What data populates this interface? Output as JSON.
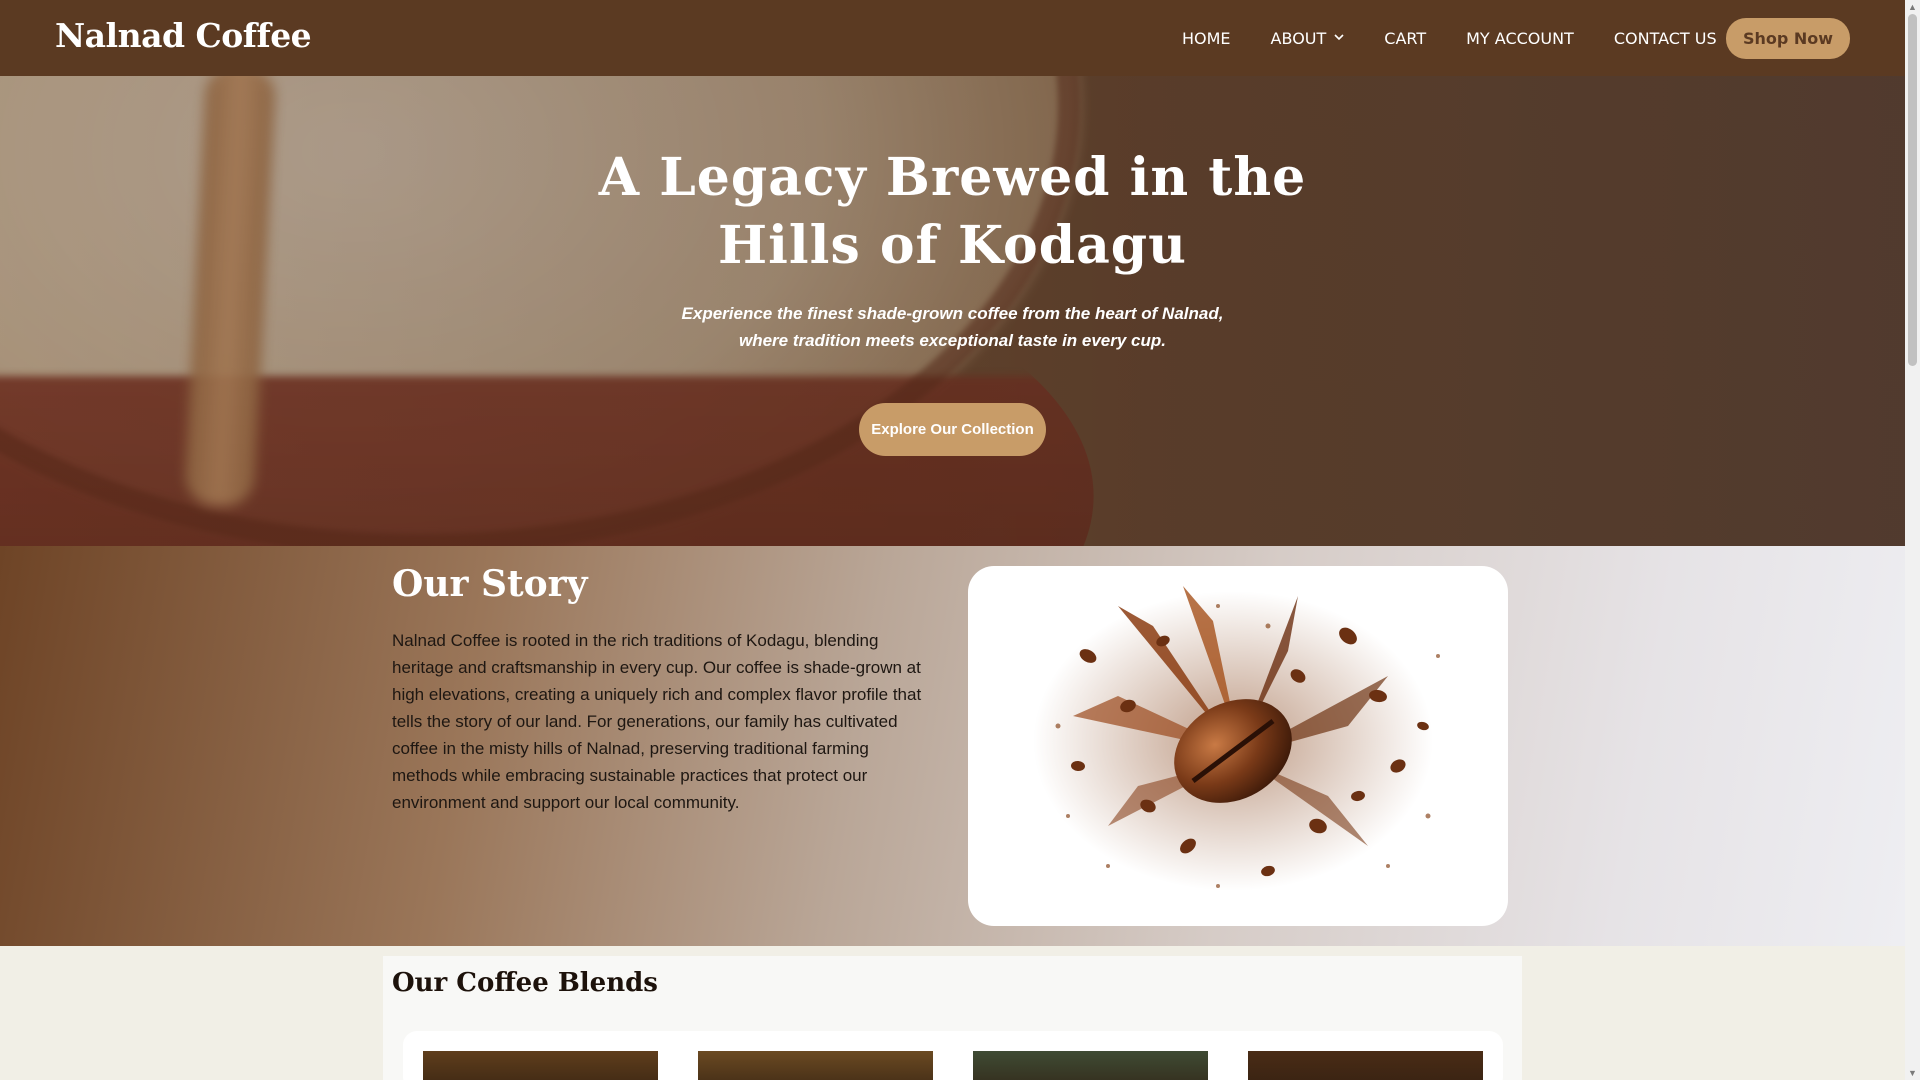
{
  "header": {
    "logo": "Nalnad Coffee",
    "nav": [
      {
        "label": "HOME"
      },
      {
        "label": "ABOUT",
        "has_dropdown": true
      },
      {
        "label": "CART"
      },
      {
        "label": "MY ACCOUNT"
      },
      {
        "label": "CONTACT US"
      }
    ],
    "shop_button": "Shop Now"
  },
  "hero": {
    "title": "A Legacy Brewed in the Hills of Kodagu",
    "subtitle_line1": "Experience the finest shade-grown coffee from the heart of Nalnad,",
    "subtitle_line2": "where tradition meets exceptional taste in every cup.",
    "cta": "Explore Our Collection"
  },
  "story": {
    "title": "Our Story",
    "text": "Nalnad Coffee is rooted in the rich traditions of Kodagu, blending heritage and craftsmanship in every cup. Our coffee is shade-grown at high elevations, creating a uniquely rich and complex flavor profile that tells the story of our land. For generations, our family has cultivated coffee in the misty hills of Nalnad, preserving traditional farming methods while embracing sustainable practices that protect our environment and support our local community.",
    "image": "coffee-bean-splash"
  },
  "blends": {
    "title": "Our Coffee Blends",
    "card_colors": [
      "#5f3e1c",
      "#6b4a22",
      "#3f4b34",
      "#4a2c16"
    ]
  },
  "colors": {
    "header_bg": "#5b3a22",
    "accent": "#c89c68",
    "page_bg": "#f1efe6"
  }
}
